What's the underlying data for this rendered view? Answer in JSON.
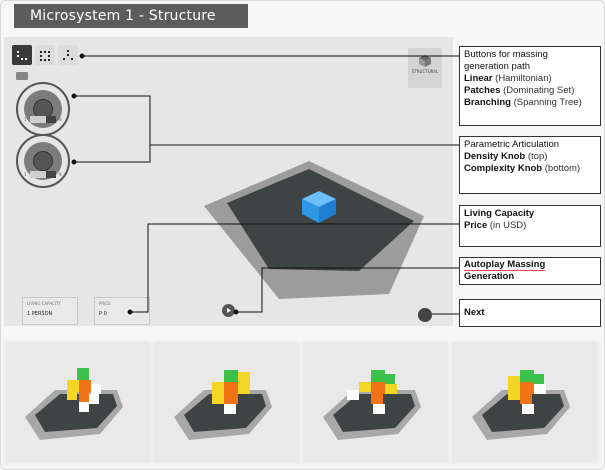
{
  "title": "Microsystem 1 - Structure",
  "toolbar": {
    "modes": [
      {
        "name": "linear",
        "active": true
      },
      {
        "name": "patches",
        "active": false
      },
      {
        "name": "branching",
        "active": false
      }
    ],
    "structural_label": "STRUCTURAL"
  },
  "knobs": {
    "density": {
      "min": "1",
      "max": "9"
    },
    "complexity": {
      "min": "1",
      "max": "9"
    }
  },
  "info": {
    "living_capacity_label": "LIVING CAPACITY",
    "living_capacity_value": "1 PERSON",
    "price_label": "PRICE",
    "price_value": "P 0"
  },
  "annotations": {
    "massing": {
      "line1": "Buttons for massing",
      "line2": "generation path",
      "items": [
        {
          "bold": "Linear",
          "rest": " (Hamiltonian)"
        },
        {
          "bold": "Patches",
          "rest": " (Dominating Set)"
        },
        {
          "bold": "Branching",
          "rest": " (Spanning Tree)"
        }
      ]
    },
    "parametric": {
      "line1": "Parametric Articulation",
      "items": [
        {
          "bold": "Density Knob",
          "rest": " (top)"
        },
        {
          "bold": "Complexity Knob",
          "rest": " (bottom)"
        }
      ]
    },
    "capacity": {
      "bold1": "Living Capacity",
      "bold2": "Price",
      "rest2": " (in USD)"
    },
    "autoplay": {
      "line1": "Autoplay Massing",
      "line2": "Generation"
    },
    "next": {
      "label": "Next"
    }
  },
  "colors": {
    "cube": "#2f9be9",
    "site_dark": "#3d4243",
    "site_light": "#8f8f8f",
    "green": "#3cc24a",
    "yellow": "#f3d626",
    "orange": "#f07415",
    "white": "#ffffff"
  },
  "thumbnails": [
    {
      "name": "massing-variant-1"
    },
    {
      "name": "massing-variant-2"
    },
    {
      "name": "massing-variant-3"
    },
    {
      "name": "massing-variant-4"
    }
  ]
}
